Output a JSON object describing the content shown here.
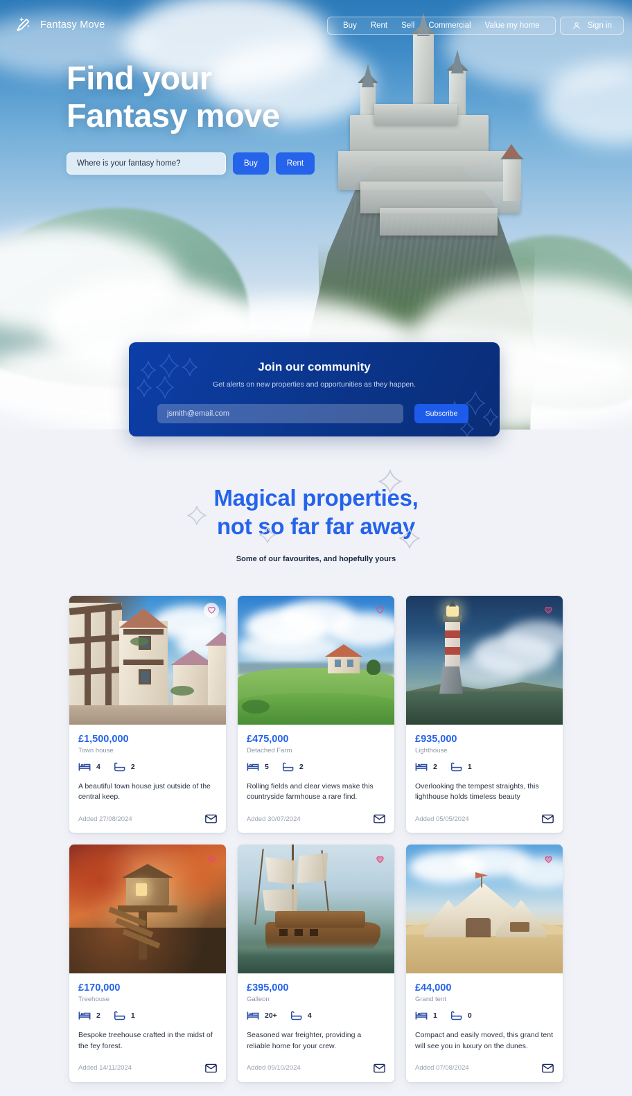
{
  "header": {
    "brand": "Fantasy Move",
    "brand_icon": "magic-wand-icon",
    "nav": [
      {
        "label": "Buy"
      },
      {
        "label": "Rent"
      },
      {
        "label": "Sell"
      },
      {
        "label": "Commercial"
      },
      {
        "label": "Value my home"
      }
    ],
    "signin": {
      "label": "Sign in",
      "icon": "user-icon"
    }
  },
  "hero": {
    "title_line1": "Find your",
    "title_line2": "Fantasy move",
    "search": {
      "placeholder": "Where is your fantasy home?",
      "value": ""
    },
    "buy_label": "Buy",
    "rent_label": "Rent"
  },
  "newsletter": {
    "title": "Join our community",
    "subtitle": "Get alerts on new properties and opportunities as they happen.",
    "email_placeholder": "jsmith@email.com",
    "email_value": "",
    "subscribe_label": "Subscribe"
  },
  "properties_section": {
    "title_line1": "Magical properties,",
    "title_line2": "not so far far away",
    "subtitle": "Some of our favourites, and hopefully yours"
  },
  "cards": [
    {
      "price": "£1,500,000",
      "type": "Town house",
      "beds": "4",
      "baths": "2",
      "description": "A beautiful town house just outside of the central keep.",
      "added": "Added 27/08/2024",
      "favourite_icon": "heart-icon",
      "contact_icon": "envelope-icon",
      "image_alt": "half-timbered town street"
    },
    {
      "price": "£475,000",
      "type": "Detached Farm",
      "beds": "5",
      "baths": "2",
      "description": "Rolling fields and clear views make this countryside farmhouse a rare find.",
      "added": "Added 30/07/2024",
      "favourite_icon": "heart-icon",
      "contact_icon": "envelope-icon",
      "image_alt": "green hills farmhouse"
    },
    {
      "price": "£935,000",
      "type": "Lighthouse",
      "beds": "2",
      "baths": "1",
      "description": "Overlooking the tempest straights, this lighthouse holds timeless beauty",
      "added": "Added 05/05/2024",
      "favourite_icon": "heart-icon",
      "contact_icon": "envelope-icon",
      "image_alt": "cliffside lighthouse"
    },
    {
      "price": "£170,000",
      "type": "Treehouse",
      "beds": "2",
      "baths": "1",
      "description": "Bespoke treehouse crafted in the midst of the fey forest.",
      "added": "Added 14/11/2024",
      "favourite_icon": "heart-icon",
      "contact_icon": "envelope-icon",
      "image_alt": "autumn forest treehouse"
    },
    {
      "price": "£395,000",
      "type": "Galleon",
      "beds": "20+",
      "baths": "4",
      "description": "Seasoned war freighter, providing a reliable home for your crew.",
      "added": "Added 09/10/2024",
      "favourite_icon": "heart-icon",
      "contact_icon": "envelope-icon",
      "image_alt": "docked wooden galleon"
    },
    {
      "price": "£44,000",
      "type": "Grand tent",
      "beds": "1",
      "baths": "0",
      "description": "Compact and easily moved, this grand tent will see you in luxury on the dunes.",
      "added": "Added 07/08/2024",
      "favourite_icon": "heart-icon",
      "contact_icon": "envelope-icon",
      "image_alt": "desert grand tent"
    }
  ],
  "colors": {
    "accent_blue": "#2563eb",
    "deep_blue": "#0b378f",
    "page_bg": "#f0f2f7",
    "heart_pink": "#e8467c",
    "muted_text": "#8d95a6"
  }
}
